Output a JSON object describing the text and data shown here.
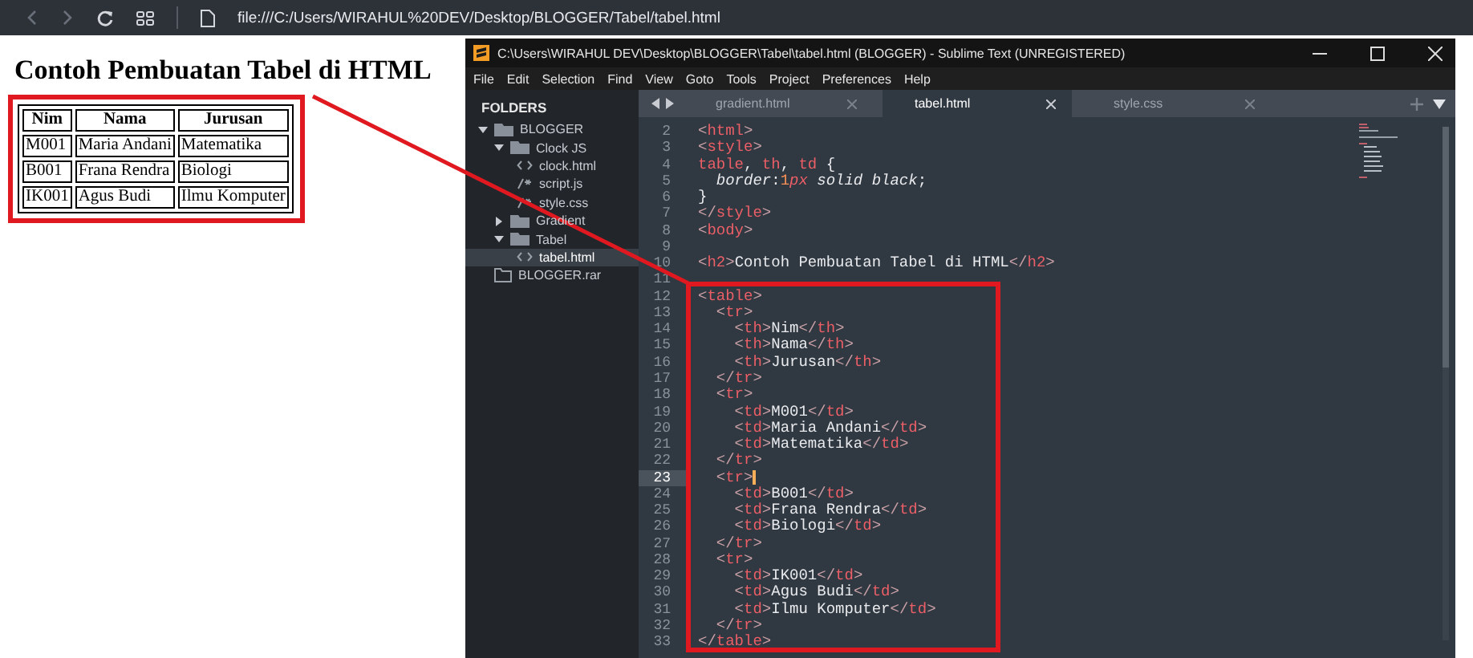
{
  "browser": {
    "url": "file:///C:/Users/WIRAHUL%20DEV/Desktop/BLOGGER/Tabel/tabel.html",
    "back_disabled": true,
    "forward_disabled": true
  },
  "page": {
    "heading": "Contoh Pembuatan Tabel di HTML",
    "table": {
      "columns": [
        "Nim",
        "Nama",
        "Jurusan"
      ],
      "rows": [
        [
          "M001",
          "Maria Andani",
          "Matematika"
        ],
        [
          "B001",
          "Frana Rendra",
          "Biologi"
        ],
        [
          "IK001",
          "Agus Budi",
          "Ilmu Komputer"
        ]
      ]
    }
  },
  "editor": {
    "title": "C:\\Users\\WIRAHUL DEV\\Desktop\\BLOGGER\\Tabel\\tabel.html (BLOGGER) - Sublime Text (UNREGISTERED)",
    "menu": [
      "File",
      "Edit",
      "Selection",
      "Find",
      "View",
      "Goto",
      "Tools",
      "Project",
      "Preferences",
      "Help"
    ],
    "sidebar": {
      "header": "FOLDERS",
      "tree": [
        {
          "label": "BLOGGER",
          "kind": "folder",
          "expanded": true,
          "selected": false,
          "children": [
            {
              "label": "Clock JS",
              "kind": "folder",
              "expanded": true,
              "selected": false,
              "children": [
                {
                  "label": "clock.html",
                  "kind": "markup",
                  "selected": false
                },
                {
                  "label": "script.js",
                  "kind": "script",
                  "selected": false
                },
                {
                  "label": "style.css",
                  "kind": "script",
                  "selected": false
                }
              ]
            },
            {
              "label": "Gradient",
              "kind": "folder",
              "expanded": false,
              "selected": false
            },
            {
              "label": "Tabel",
              "kind": "folder",
              "expanded": true,
              "selected": false,
              "children": [
                {
                  "label": "tabel.html",
                  "kind": "markup",
                  "selected": true
                }
              ]
            },
            {
              "label": "BLOGGER.rar",
              "kind": "archive",
              "selected": false
            }
          ]
        }
      ]
    },
    "tabs": [
      {
        "label": "gradient.html",
        "selected": false
      },
      {
        "label": "tabel.html",
        "selected": true
      },
      {
        "label": "style.css",
        "selected": false
      }
    ],
    "lines": [
      {
        "number": "2",
        "current": false,
        "tokens": [
          {
            "kind": "punct",
            "text": "<"
          },
          {
            "kind": "tag",
            "text": "html"
          },
          {
            "kind": "punct",
            "text": ">"
          }
        ]
      },
      {
        "number": "3",
        "current": false,
        "tokens": [
          {
            "kind": "punct",
            "text": "<"
          },
          {
            "kind": "tag",
            "text": "style"
          },
          {
            "kind": "punct",
            "text": ">"
          }
        ]
      },
      {
        "number": "4",
        "current": false,
        "tokens": [
          {
            "kind": "tag",
            "text": "table"
          },
          {
            "kind": "text",
            "text": ", "
          },
          {
            "kind": "tag",
            "text": "th"
          },
          {
            "kind": "text",
            "text": ", "
          },
          {
            "kind": "tag",
            "text": "td"
          },
          {
            "kind": "text",
            "text": " {"
          }
        ]
      },
      {
        "number": "5",
        "current": false,
        "tokens": [
          {
            "kind": "prop",
            "text": "  border"
          },
          {
            "kind": "text",
            "text": ":"
          },
          {
            "kind": "num",
            "text": "1"
          },
          {
            "kind": "unit",
            "text": "px"
          },
          {
            "kind": "prop",
            "text": " solid black"
          },
          {
            "kind": "text",
            "text": ";"
          }
        ]
      },
      {
        "number": "6",
        "current": false,
        "tokens": [
          {
            "kind": "text",
            "text": "}"
          }
        ]
      },
      {
        "number": "7",
        "current": false,
        "tokens": [
          {
            "kind": "punct",
            "text": "</"
          },
          {
            "kind": "tag",
            "text": "style"
          },
          {
            "kind": "punct",
            "text": ">"
          }
        ]
      },
      {
        "number": "8",
        "current": false,
        "tokens": [
          {
            "kind": "punct",
            "text": "<"
          },
          {
            "kind": "tag",
            "text": "body"
          },
          {
            "kind": "punct",
            "text": ">"
          }
        ]
      },
      {
        "number": "9",
        "current": false
      },
      {
        "number": "10",
        "current": false,
        "tokens": [
          {
            "kind": "punct",
            "text": "<"
          },
          {
            "kind": "tag",
            "text": "h2"
          },
          {
            "kind": "punct",
            "text": ">"
          },
          {
            "kind": "text",
            "text": "Contoh Pembuatan Tabel di HTML"
          },
          {
            "kind": "punct",
            "text": "</"
          },
          {
            "kind": "tag",
            "text": "h2"
          },
          {
            "kind": "punct",
            "text": ">"
          }
        ]
      },
      {
        "number": "11",
        "current": false
      },
      {
        "number": "12",
        "current": false,
        "tokens": [
          {
            "kind": "punct",
            "text": "<"
          },
          {
            "kind": "tag",
            "text": "table"
          },
          {
            "kind": "punct",
            "text": ">"
          }
        ]
      },
      {
        "number": "13",
        "current": false,
        "tokens": [
          {
            "kind": "punct",
            "text": "  <"
          },
          {
            "kind": "tag",
            "text": "tr"
          },
          {
            "kind": "punct",
            "text": ">"
          }
        ]
      },
      {
        "number": "14",
        "current": false,
        "tokens": [
          {
            "kind": "punct",
            "text": "    <"
          },
          {
            "kind": "tag",
            "text": "th"
          },
          {
            "kind": "punct",
            "text": ">"
          },
          {
            "kind": "text",
            "text": "Nim"
          },
          {
            "kind": "punct",
            "text": "</"
          },
          {
            "kind": "tag",
            "text": "th"
          },
          {
            "kind": "punct",
            "text": ">"
          }
        ]
      },
      {
        "number": "15",
        "current": false,
        "tokens": [
          {
            "kind": "punct",
            "text": "    <"
          },
          {
            "kind": "tag",
            "text": "th"
          },
          {
            "kind": "punct",
            "text": ">"
          },
          {
            "kind": "text",
            "text": "Nama"
          },
          {
            "kind": "punct",
            "text": "</"
          },
          {
            "kind": "tag",
            "text": "th"
          },
          {
            "kind": "punct",
            "text": ">"
          }
        ]
      },
      {
        "number": "16",
        "current": false,
        "tokens": [
          {
            "kind": "punct",
            "text": "    <"
          },
          {
            "kind": "tag",
            "text": "th"
          },
          {
            "kind": "punct",
            "text": ">"
          },
          {
            "kind": "text",
            "text": "Jurusan"
          },
          {
            "kind": "punct",
            "text": "</"
          },
          {
            "kind": "tag",
            "text": "th"
          },
          {
            "kind": "punct",
            "text": ">"
          }
        ]
      },
      {
        "number": "17",
        "current": false,
        "tokens": [
          {
            "kind": "punct",
            "text": "  </"
          },
          {
            "kind": "tag",
            "text": "tr"
          },
          {
            "kind": "punct",
            "text": ">"
          }
        ]
      },
      {
        "number": "18",
        "current": false,
        "tokens": [
          {
            "kind": "punct",
            "text": "  <"
          },
          {
            "kind": "tag",
            "text": "tr"
          },
          {
            "kind": "punct",
            "text": ">"
          }
        ]
      },
      {
        "number": "19",
        "current": false,
        "tokens": [
          {
            "kind": "punct",
            "text": "    <"
          },
          {
            "kind": "tag",
            "text": "td"
          },
          {
            "kind": "punct",
            "text": ">"
          },
          {
            "kind": "text",
            "text": "M001"
          },
          {
            "kind": "punct",
            "text": "</"
          },
          {
            "kind": "tag",
            "text": "td"
          },
          {
            "kind": "punct",
            "text": ">"
          }
        ]
      },
      {
        "number": "20",
        "current": false,
        "tokens": [
          {
            "kind": "punct",
            "text": "    <"
          },
          {
            "kind": "tag",
            "text": "td"
          },
          {
            "kind": "punct",
            "text": ">"
          },
          {
            "kind": "text",
            "text": "Maria Andani"
          },
          {
            "kind": "punct",
            "text": "</"
          },
          {
            "kind": "tag",
            "text": "td"
          },
          {
            "kind": "punct",
            "text": ">"
          }
        ]
      },
      {
        "number": "21",
        "current": false,
        "tokens": [
          {
            "kind": "punct",
            "text": "    <"
          },
          {
            "kind": "tag",
            "text": "td"
          },
          {
            "kind": "punct",
            "text": ">"
          },
          {
            "kind": "text",
            "text": "Matematika"
          },
          {
            "kind": "punct",
            "text": "</"
          },
          {
            "kind": "tag",
            "text": "td"
          },
          {
            "kind": "punct",
            "text": ">"
          }
        ]
      },
      {
        "number": "22",
        "current": false,
        "tokens": [
          {
            "kind": "punct",
            "text": "  </"
          },
          {
            "kind": "tag",
            "text": "tr"
          },
          {
            "kind": "punct",
            "text": ">"
          }
        ]
      },
      {
        "number": "23",
        "current": true,
        "tokens": [
          {
            "kind": "punct",
            "text": "  <"
          },
          {
            "kind": "tag",
            "text": "tr"
          },
          {
            "kind": "punct",
            "text": ">"
          }
        ]
      },
      {
        "number": "24",
        "current": false,
        "tokens": [
          {
            "kind": "punct",
            "text": "    <"
          },
          {
            "kind": "tag",
            "text": "td"
          },
          {
            "kind": "punct",
            "text": ">"
          },
          {
            "kind": "text",
            "text": "B001"
          },
          {
            "kind": "punct",
            "text": "</"
          },
          {
            "kind": "tag",
            "text": "td"
          },
          {
            "kind": "punct",
            "text": ">"
          }
        ]
      },
      {
        "number": "25",
        "current": false,
        "tokens": [
          {
            "kind": "punct",
            "text": "    <"
          },
          {
            "kind": "tag",
            "text": "td"
          },
          {
            "kind": "punct",
            "text": ">"
          },
          {
            "kind": "text",
            "text": "Frana Rendra"
          },
          {
            "kind": "punct",
            "text": "</"
          },
          {
            "kind": "tag",
            "text": "td"
          },
          {
            "kind": "punct",
            "text": ">"
          }
        ]
      },
      {
        "number": "26",
        "current": false,
        "tokens": [
          {
            "kind": "punct",
            "text": "    <"
          },
          {
            "kind": "tag",
            "text": "td"
          },
          {
            "kind": "punct",
            "text": ">"
          },
          {
            "kind": "text",
            "text": "Biologi"
          },
          {
            "kind": "punct",
            "text": "</"
          },
          {
            "kind": "tag",
            "text": "td"
          },
          {
            "kind": "punct",
            "text": ">"
          }
        ]
      },
      {
        "number": "27",
        "current": false,
        "tokens": [
          {
            "kind": "punct",
            "text": "  </"
          },
          {
            "kind": "tag",
            "text": "tr"
          },
          {
            "kind": "punct",
            "text": ">"
          }
        ]
      },
      {
        "number": "28",
        "current": false,
        "tokens": [
          {
            "kind": "punct",
            "text": "  <"
          },
          {
            "kind": "tag",
            "text": "tr"
          },
          {
            "kind": "punct",
            "text": ">"
          }
        ]
      },
      {
        "number": "29",
        "current": false,
        "tokens": [
          {
            "kind": "punct",
            "text": "    <"
          },
          {
            "kind": "tag",
            "text": "td"
          },
          {
            "kind": "punct",
            "text": ">"
          },
          {
            "kind": "text",
            "text": "IK001"
          },
          {
            "kind": "punct",
            "text": "</"
          },
          {
            "kind": "tag",
            "text": "td"
          },
          {
            "kind": "punct",
            "text": ">"
          }
        ]
      },
      {
        "number": "30",
        "current": false,
        "tokens": [
          {
            "kind": "punct",
            "text": "    <"
          },
          {
            "kind": "tag",
            "text": "td"
          },
          {
            "kind": "punct",
            "text": ">"
          },
          {
            "kind": "text",
            "text": "Agus Budi"
          },
          {
            "kind": "punct",
            "text": "</"
          },
          {
            "kind": "tag",
            "text": "td"
          },
          {
            "kind": "punct",
            "text": ">"
          }
        ]
      },
      {
        "number": "31",
        "current": false,
        "tokens": [
          {
            "kind": "punct",
            "text": "    <"
          },
          {
            "kind": "tag",
            "text": "td"
          },
          {
            "kind": "punct",
            "text": ">"
          },
          {
            "kind": "text",
            "text": "Ilmu Komputer"
          },
          {
            "kind": "punct",
            "text": "</"
          },
          {
            "kind": "tag",
            "text": "td"
          },
          {
            "kind": "punct",
            "text": ">"
          }
        ]
      },
      {
        "number": "32",
        "current": false,
        "tokens": [
          {
            "kind": "punct",
            "text": "  </"
          },
          {
            "kind": "tag",
            "text": "tr"
          },
          {
            "kind": "punct",
            "text": ">"
          }
        ]
      },
      {
        "number": "33",
        "current": false,
        "tokens": [
          {
            "kind": "punct",
            "text": "</"
          },
          {
            "kind": "tag",
            "text": "table"
          },
          {
            "kind": "punct",
            "text": ">"
          }
        ]
      }
    ]
  }
}
